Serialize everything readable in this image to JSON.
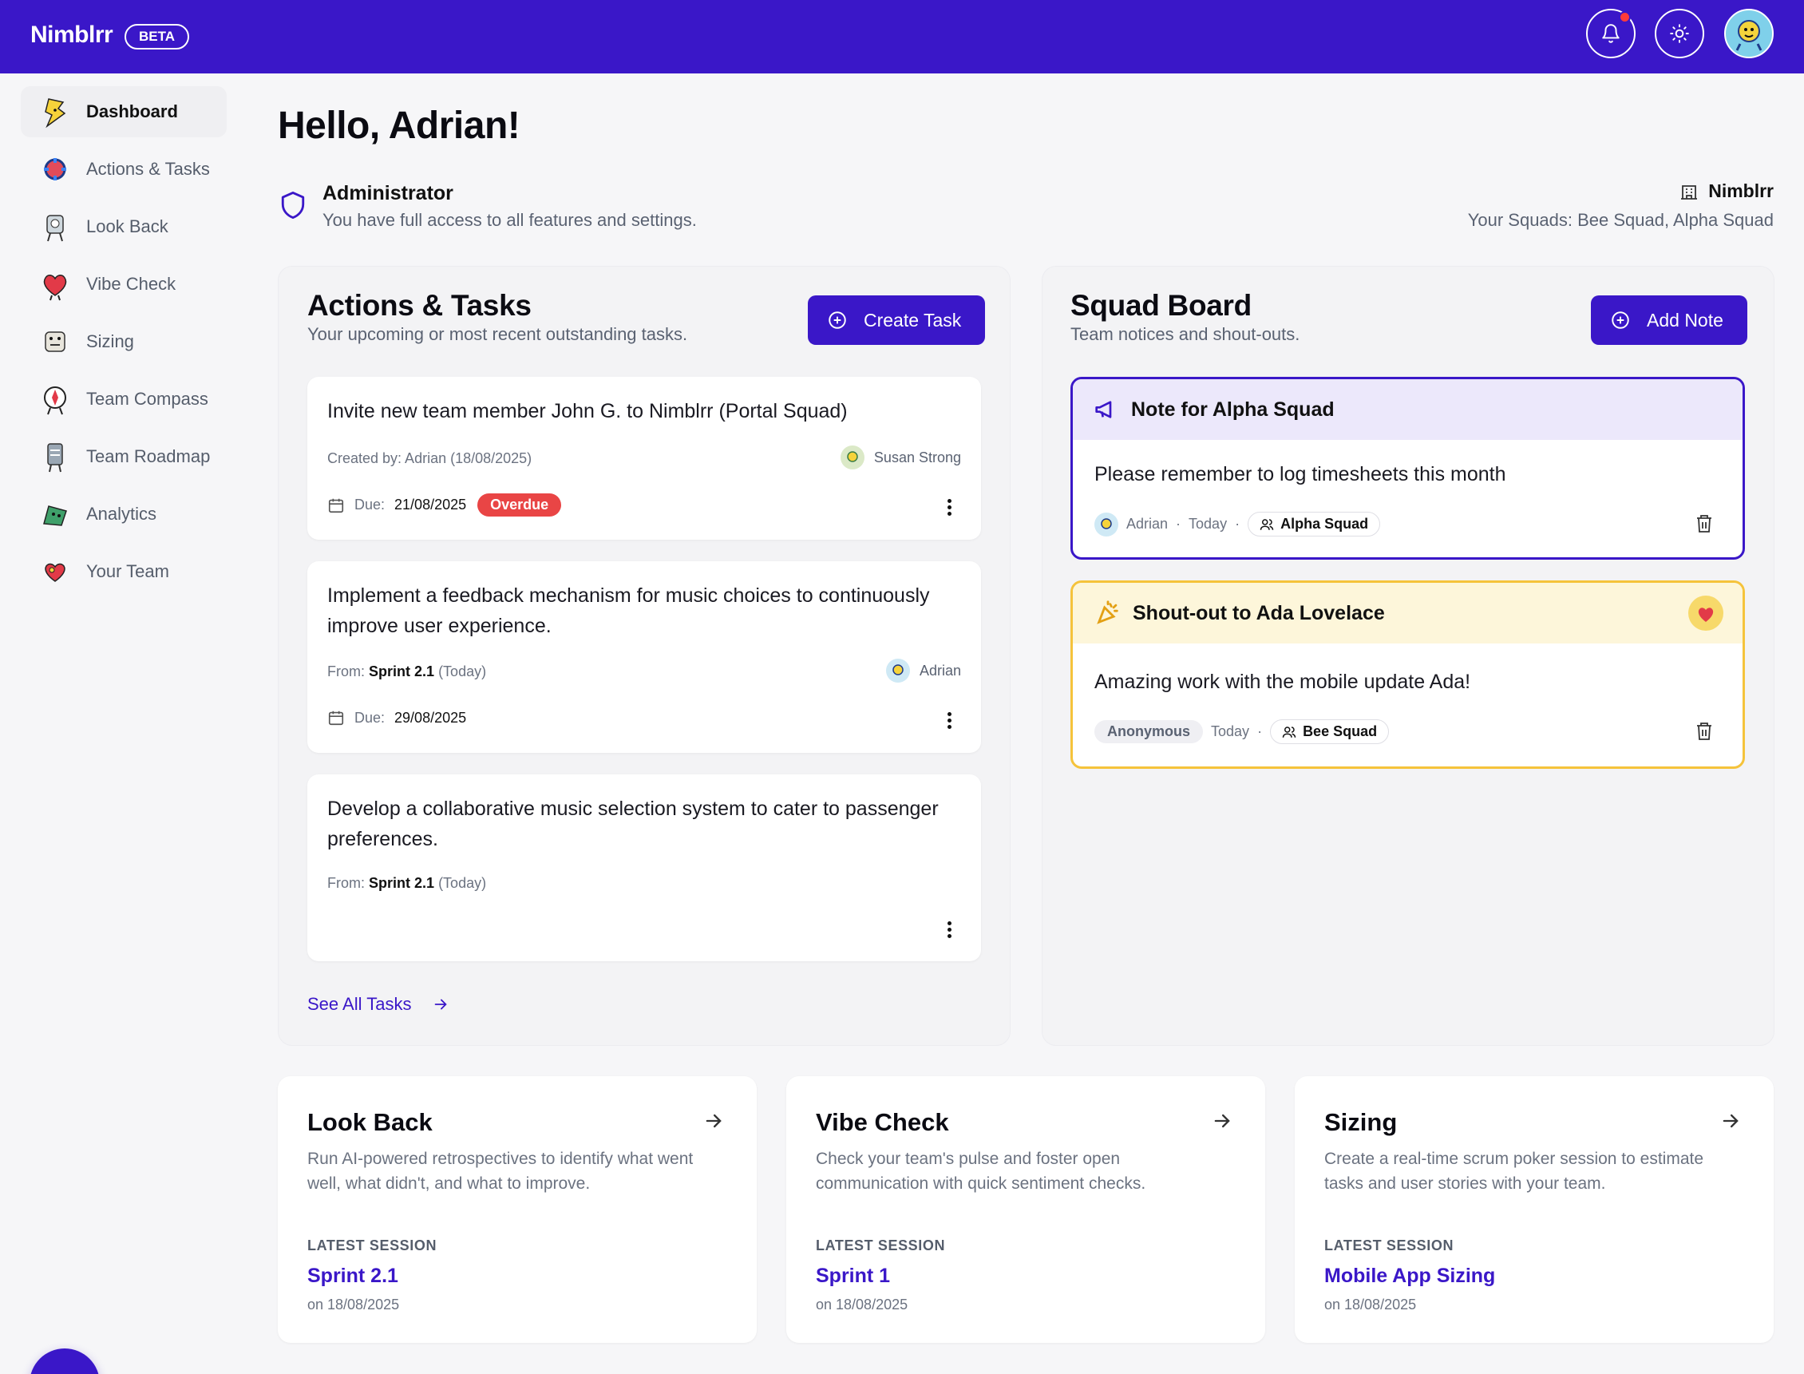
{
  "header": {
    "brand": "Nimblrr",
    "beta": "BETA",
    "colors": {
      "primary": "#3a17c8",
      "danger": "#e94545",
      "note_alpha_border": "#3a17c8",
      "note_shout_border": "#f5c33b"
    }
  },
  "sidebar": {
    "items": [
      {
        "label": "Dashboard",
        "icon": "dashboard-mascot-icon",
        "active": true
      },
      {
        "label": "Actions & Tasks",
        "icon": "actions-mascot-icon"
      },
      {
        "label": "Look Back",
        "icon": "lookback-mascot-icon"
      },
      {
        "label": "Vibe Check",
        "icon": "vibecheck-mascot-icon"
      },
      {
        "label": "Sizing",
        "icon": "sizing-mascot-icon"
      },
      {
        "label": "Team Compass",
        "icon": "compass-mascot-icon"
      },
      {
        "label": "Team Roadmap",
        "icon": "roadmap-mascot-icon"
      },
      {
        "label": "Analytics",
        "icon": "analytics-mascot-icon"
      },
      {
        "label": "Your Team",
        "icon": "team-mascot-icon"
      }
    ]
  },
  "main": {
    "greeting": "Hello, Adrian!",
    "role": {
      "title": "Administrator",
      "desc": "You have full access to all features and settings."
    },
    "org": {
      "name": "Nimblrr",
      "squads": "Your Squads: Bee Squad, Alpha Squad"
    }
  },
  "tasks": {
    "title": "Actions & Tasks",
    "subtitle": "Your upcoming or most recent outstanding tasks.",
    "create_label": "Create Task",
    "see_all": "See All Tasks",
    "items": [
      {
        "title": "Invite new team member John G. to Nimblrr (Portal Squad)",
        "meta": "Created by: Adrian (18/08/2025)",
        "assignee": "Susan Strong",
        "due_label": "Due:",
        "due": "21/08/2025",
        "badge": "Overdue"
      },
      {
        "title": "Implement a feedback mechanism for music choices to continuously improve user experience.",
        "meta_from": "From:",
        "meta_sprint": "Sprint 2.1",
        "meta_when": "(Today)",
        "assignee": "Adrian",
        "due_label": "Due:",
        "due": "29/08/2025"
      },
      {
        "title": "Develop a collaborative music selection system to cater to passenger preferences.",
        "meta_from": "From:",
        "meta_sprint": "Sprint 2.1",
        "meta_when": "(Today)"
      }
    ]
  },
  "squad_board": {
    "title": "Squad Board",
    "subtitle": "Team notices and shout-outs.",
    "add_label": "Add Note",
    "notes": [
      {
        "title": "Note for Alpha Squad",
        "body": "Please remember to log timesheets this month",
        "author": "Adrian",
        "when": "Today",
        "squad": "Alpha Squad"
      },
      {
        "title": "Shout-out to Ada Lovelace",
        "body": "Amazing work with the mobile update Ada!",
        "author": "Anonymous",
        "when": "Today",
        "squad": "Bee Squad"
      }
    ]
  },
  "features": [
    {
      "title": "Look Back",
      "desc": "Run AI-powered retrospectives to identify what went well, what didn't, and what to improve.",
      "latest_label": "LATEST SESSION",
      "session": "Sprint 2.1",
      "date": "on 18/08/2025"
    },
    {
      "title": "Vibe Check",
      "desc": "Check your team's pulse and foster open communication with quick sentiment checks.",
      "latest_label": "LATEST SESSION",
      "session": "Sprint 1",
      "date": "on 18/08/2025"
    },
    {
      "title": "Sizing",
      "desc": "Create a real-time scrum poker session to estimate tasks and user stories with your team.",
      "latest_label": "LATEST SESSION",
      "session": "Mobile App Sizing",
      "date": "on 18/08/2025"
    }
  ]
}
